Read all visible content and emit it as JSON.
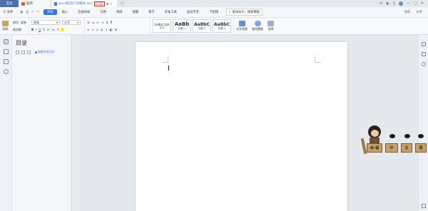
{
  "tabs": {
    "home": "首页",
    "shell": "稻壳",
    "doc_name": "word取消只读模式.doc",
    "readonly_badge": "[只读]",
    "new_tab": "+"
  },
  "titlebar_right": [
    "1"
  ],
  "menubar": {
    "file": "三 文件",
    "items": [
      "开始",
      "插入",
      "页面布局",
      "引用",
      "审阅",
      "视图",
      "章节",
      "开发工具",
      "会员专享",
      "下划线"
    ],
    "search": "查找命令、搜索模板",
    "right": [
      "协作",
      "分享"
    ]
  },
  "ribbon": {
    "paste": "粘贴",
    "cut": "剪切",
    "copy": "复制",
    "format_painter": "格式刷",
    "font_name": "宋体",
    "font_size": "五号",
    "styles": [
      {
        "sample": "AaBbCcDd",
        "caption": "正文"
      },
      {
        "sample": "AaBb",
        "caption": "标题 1"
      },
      {
        "sample": "AaBbC",
        "caption": "标题 2"
      },
      {
        "sample": "AaBbC",
        "caption": "标题 3"
      }
    ],
    "text_tools": "文字排版",
    "find_replace": "查找替换",
    "select": "选择"
  },
  "toc": {
    "title": "目录",
    "smart": "智能识别目录"
  },
  "cartoon": {
    "boards": [
      "会·福",
      "中",
      "文",
      "网"
    ]
  },
  "colors": {
    "accent": "#3b74d6",
    "readonly_red": "#d21f1f",
    "home_tab": "#4e6fae"
  }
}
